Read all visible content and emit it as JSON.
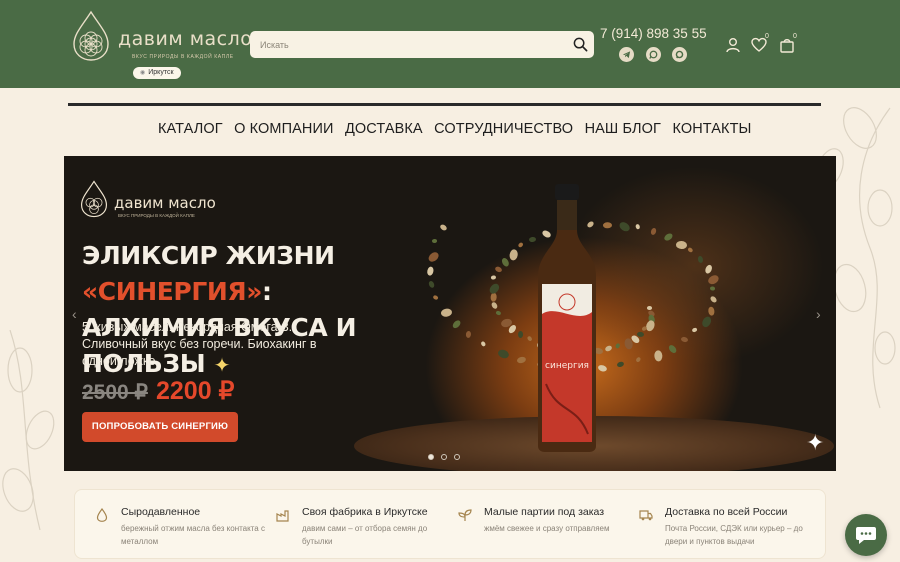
{
  "header": {
    "logo_text": "давим масло",
    "logo_tagline": "ВКУС ПРИРОДЫ В КАЖДОЙ КАПЛЕ",
    "city": "Иркутск",
    "search_placeholder": "Искать",
    "phone": "7 (914) 898 35 55",
    "messengers": [
      "telegram-icon",
      "whatsapp-icon",
      "max-icon"
    ],
    "favorites_count": "0",
    "cart_count": "0"
  },
  "nav": {
    "items": [
      "КАТАЛОГ",
      "О КОМПАНИИ",
      "ДОСТАВКА",
      "СОТРУДНИЧЕСТВО",
      "НАШ БЛОГ",
      "КОНТАКТЫ"
    ]
  },
  "hero": {
    "logo_text": "давим масло",
    "logo_tagline": "ВКУС ПРИРОДЫ В КАЖДОЙ КАПЛЕ",
    "title_line1_prefix": "ЭЛИКСИР ЖИЗНИ ",
    "title_line1_accent": "«СИНЕРГИЯ»",
    "title_line1_suffix": ":",
    "title_line2": "АЛХИМИЯ ВКУСА И ПОЛЬЗЫ",
    "description": "5 живых масел. Рекордная Омега-3. Сливочный вкус без горечи. Биохакинг в одной ложке.",
    "price_old": "2500 ₽",
    "price_new": "2200 ₽",
    "cta_label": "ПОПРОБОВАТЬ СИНЕРГИЮ",
    "bottle_label": "синергия",
    "slides_total": 3,
    "slide_active": 1
  },
  "features": [
    {
      "icon": "drop-icon",
      "title": "Сыродавленное",
      "desc": "бережный отжим масла без контакта с металлом"
    },
    {
      "icon": "factory-icon",
      "title": "Своя фабрика в Иркутске",
      "desc": "давим сами – от отбора семян до бутылки"
    },
    {
      "icon": "sprout-icon",
      "title": "Малые партии под заказ",
      "desc": "жмём свежее и сразу отправляем"
    },
    {
      "icon": "truck-icon",
      "title": "Доставка по всей России",
      "desc": "Почта России, СДЭК или курьер – до двери и пунктов выдачи"
    }
  ],
  "colors": {
    "header_green": "#4a6b45",
    "page_background": "#f7efe2",
    "accent_red": "#d24a2b"
  }
}
